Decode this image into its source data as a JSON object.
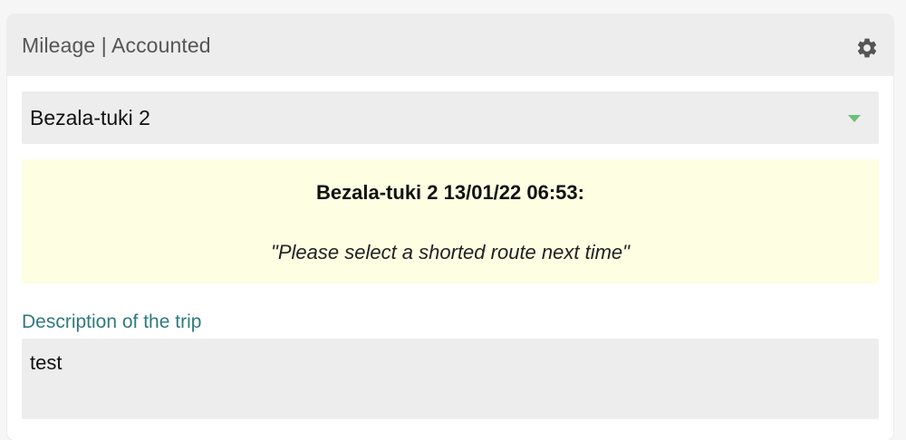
{
  "header": {
    "title": "Mileage | Accounted",
    "settings_icon": "gear-icon"
  },
  "vehicle_select": {
    "value": "Bezala-tuki 2",
    "caret_color": "#6bbf79"
  },
  "notice": {
    "title": "Bezala-tuki 2 13/01/22 06:53:",
    "message": "\"Please select a shorted route next time\"",
    "background": "#fdfee2"
  },
  "description": {
    "label": "Description of the trip",
    "value": "test"
  },
  "colors": {
    "label_accent": "#2f7a80"
  }
}
